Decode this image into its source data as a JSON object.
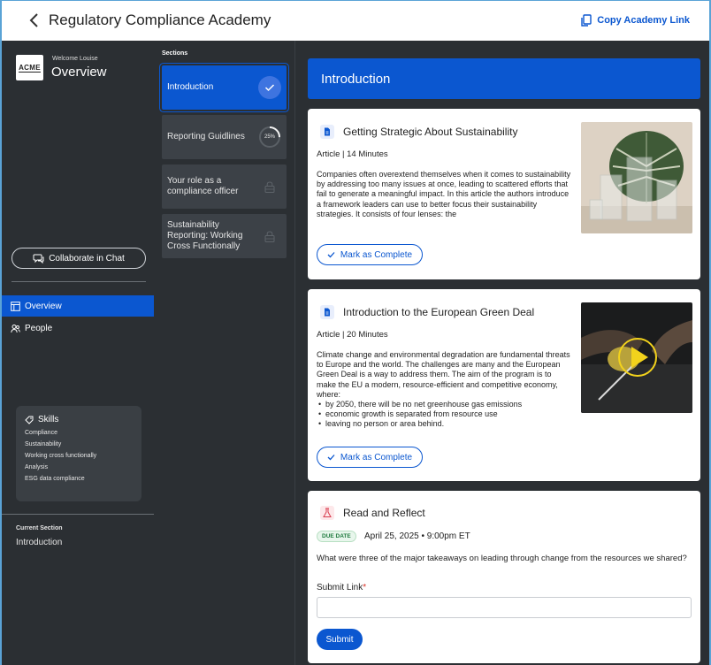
{
  "header": {
    "title": "Regulatory Compliance Academy",
    "copy_link_label": "Copy Academy Link"
  },
  "sidebar": {
    "logo_text": "ACME",
    "welcome": "Welcome Louise",
    "title": "Overview",
    "collab_label": "Collaborate in Chat",
    "nav": [
      {
        "label": "Overview",
        "icon": "layout-icon",
        "active": true
      },
      {
        "label": "People",
        "icon": "people-icon",
        "active": false
      }
    ],
    "skills": {
      "heading": "Skills",
      "items": [
        "Compliance",
        "Sustainability",
        "Working cross functionally",
        "Analysis",
        "ESG data compliance"
      ]
    },
    "current_section_label": "Current Section",
    "current_section_value": "Introduction"
  },
  "sections": {
    "label": "Sections",
    "items": [
      {
        "label": "Introduction",
        "status": "complete"
      },
      {
        "label": "Reporting Guidlines",
        "status": "progress",
        "progress": "25%"
      },
      {
        "label": "Your role as a compliance officer",
        "status": "locked"
      },
      {
        "label": "Sustainability Reporting: Working Cross Functionally",
        "status": "locked"
      }
    ]
  },
  "main": {
    "banner": "Introduction",
    "cards": [
      {
        "title": "Getting Strategic About Sustainability",
        "meta": "Article | 14 Minutes",
        "body": "Companies often overextend themselves when it comes to sustainability by addressing too many issues at once, leading to scattered efforts that fail to generate a meaningful impact. In this article the authors introduce a framework leaders can use to better focus their sustainability strategies. It consists of four lenses: the",
        "button": "Mark as Complete"
      },
      {
        "title": "Introduction to the European Green Deal",
        "meta": "Article | 20 Minutes",
        "body": "Climate change and environmental degradation are fundamental threats to Europe and the world. The challenges are many and the European Green Deal is a way to address them. The aim of the program is to make the EU a modern, resource-efficient and competitive economy, where:",
        "bullets": [
          "by 2050, there will be no net greenhouse gas emissions",
          "economic growth is separated from resource use",
          "leaving no person or area behind."
        ],
        "button": "Mark as Complete"
      }
    ],
    "reflect": {
      "title": "Read and Reflect",
      "due_badge": "DUE DATE",
      "due_date": "April 25, 2025 • 9:00pm ET",
      "question": "What were three of the major takeaways on leading through change from the resources we shared?",
      "submit_label": "Submit Link",
      "required_mark": "*",
      "input_value": "",
      "submit_button": "Submit"
    }
  },
  "colors": {
    "accent": "#0b57d0",
    "panel": "#2b2f33",
    "section_tile": "#3c4147"
  }
}
